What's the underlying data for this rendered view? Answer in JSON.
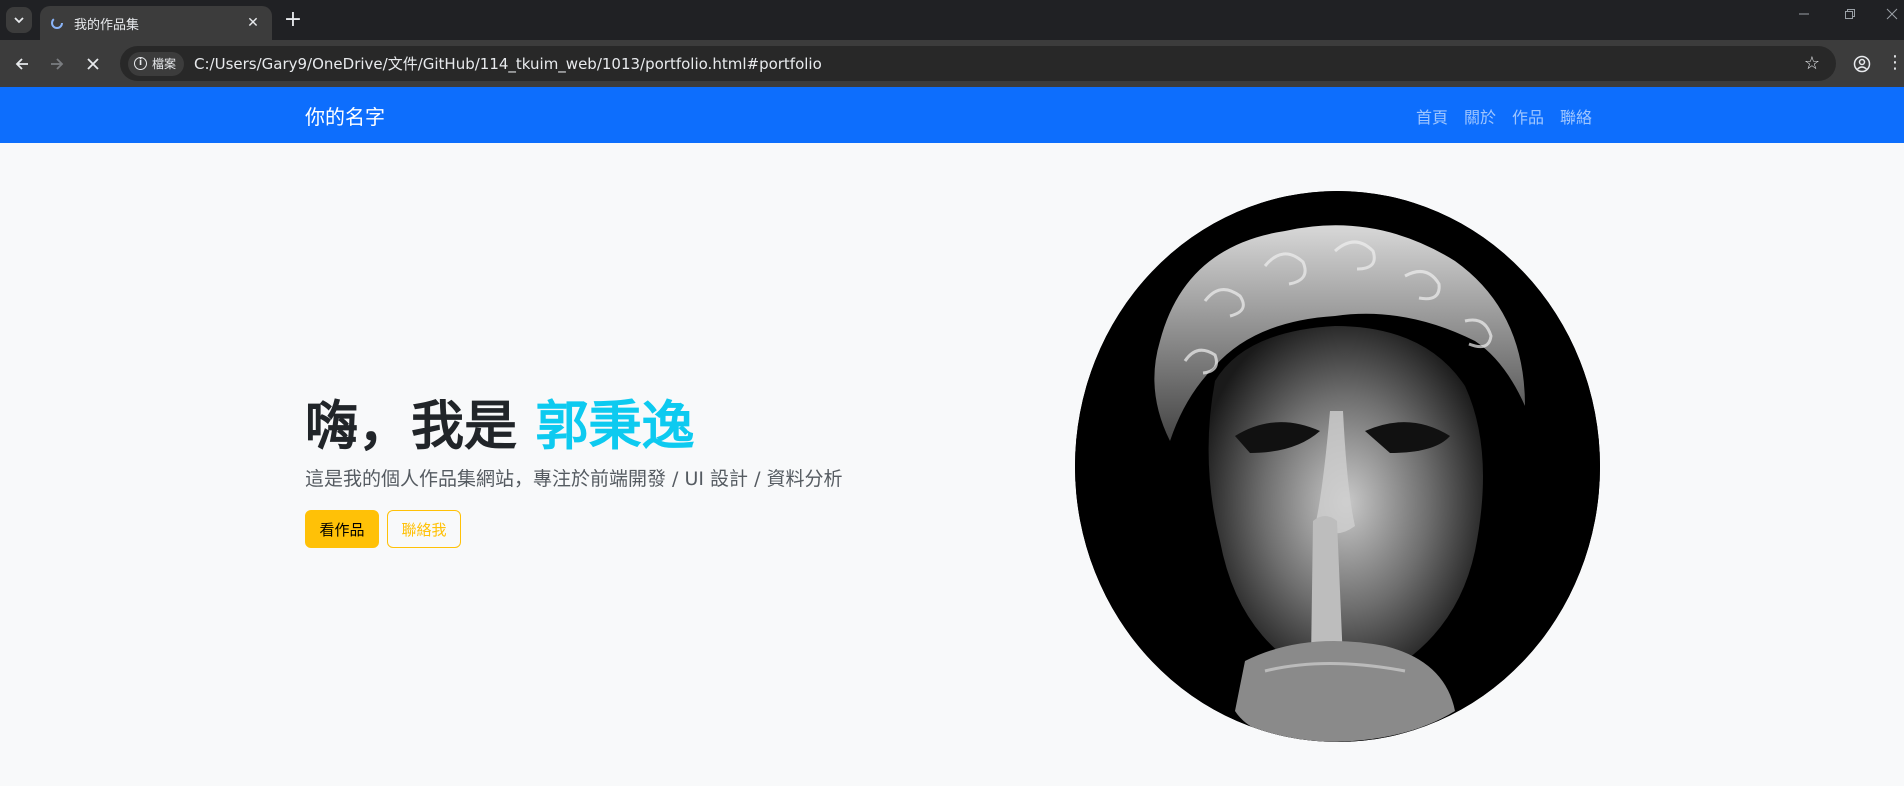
{
  "browser": {
    "tab_title": "我的作品集",
    "new_tab_symbol": "+",
    "close_symbol": "✕",
    "scheme_chip": "檔案",
    "url": "C:/Users/Gary9/OneDrive/文件/GitHub/114_tkuim_web/1013/portfolio.html#portfolio"
  },
  "navbar": {
    "brand": "你的名字",
    "links": [
      "首頁",
      "關於",
      "作品",
      "聯絡"
    ]
  },
  "hero": {
    "greeting": "嗨，我是 ",
    "name": "郭秉逸",
    "subtitle": "這是我的個人作品集網站，專注於前端開發 / UI 設計 / 資料分析",
    "primary_button": "看作品",
    "secondary_button": "聯絡我"
  },
  "colors": {
    "navbar": "#0d6efd",
    "accent_name": "#0dcaf0",
    "warning": "#ffc107",
    "page_bg": "#f8f9fa"
  }
}
